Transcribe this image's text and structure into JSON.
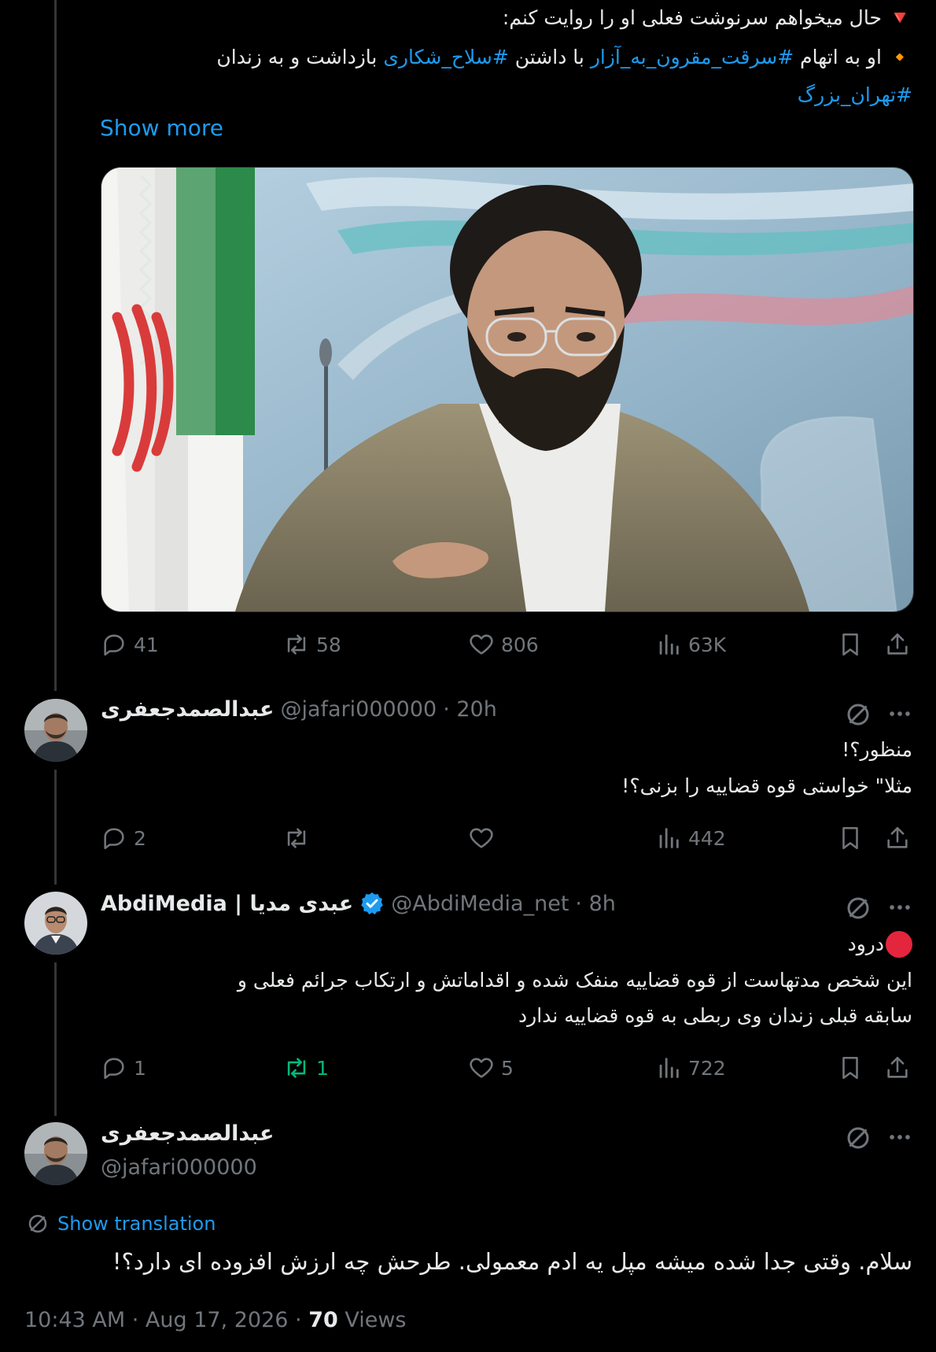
{
  "accent": "#1d9bf0",
  "retweet_active_color": "#00ba7c",
  "main_post": {
    "line1": "🔻 حال میخواهم سرنوشت فعلی او را روایت کنم:",
    "line2_prefix": "🔸 او به اتهام ",
    "hashtag1": "#سرقت_مقرون_به_آزار",
    "line2_mid": " با داشتن ",
    "hashtag2": "#سلاح_شکاری",
    "line2_suffix": " بازداشت و به زندان",
    "hashtag3": "#تهران_بزرگ",
    "show_more": "Show more",
    "image_icon": "photo-man-with-glasses-beard-iran-flag",
    "stats": {
      "replies": "41",
      "reposts": "58",
      "likes": "806",
      "views": "63K"
    }
  },
  "reply1": {
    "author": "عبدالصمدجعفری",
    "handle": "@jafari000000",
    "time": "· 20h",
    "line1": "منظور؟!",
    "line2": "مثلا\" خواستی قوه قضاییه را بزنی؟!",
    "stats": {
      "replies": "2",
      "reposts": "",
      "likes": "",
      "views": "442"
    }
  },
  "reply2": {
    "author": "AbdiMedia | عبدی مدیا",
    "handle": "@AbdiMedia_net",
    "time": "· 8h",
    "line1": "درود",
    "line2": "این شخص مدتهاست از قوه قضاییه منفک شده و اقداماتش و ارتکاب جرائم فعلی و",
    "line3": "سابقه قبلی زندان وی ربطی به قوه قضاییه ندارد",
    "stats": {
      "replies": "1",
      "reposts": "1",
      "likes": "5",
      "views": "722"
    }
  },
  "focused": {
    "author": "عبدالصمدجعفری",
    "handle": "@jafari000000",
    "show_translation": "Show translation",
    "text": "سلام. وقتی جدا شده میشه مپل یه ادم معمولی. طرحش چه ارزش افزوده ای دارد؟!",
    "timestamp": "10:43 AM · Aug 17, 2026 · ",
    "views_count": "70",
    "views_label": " Views"
  }
}
